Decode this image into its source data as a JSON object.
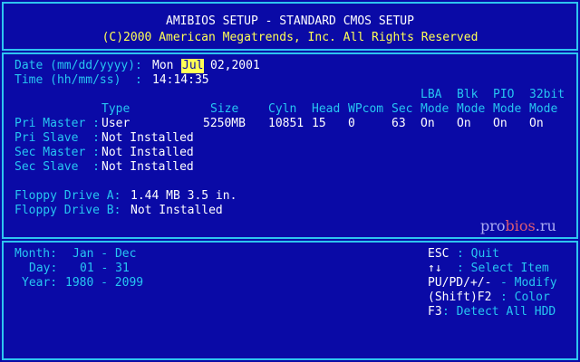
{
  "header": {
    "title": "AMIBIOS SETUP - STANDARD CMOS SETUP",
    "copyright": "(C)2000 American Megatrends, Inc. All Rights Reserved"
  },
  "datetime": {
    "date_label": "Date (mm/dd/yyyy):",
    "date_weekday": "Mon",
    "date_month": "Jul",
    "date_rest": "02,2001",
    "time_label": "Time (hh/mm/ss)  :",
    "time_value": "14:14:35"
  },
  "drives_table": {
    "columns": {
      "type": "Type",
      "size": "Size",
      "cyln": "Cyln",
      "head": "Head",
      "wpcom": "WPcom",
      "sec": "Sec",
      "lba_top": "LBA",
      "lba_bottom": "Mode",
      "blk_top": "Blk",
      "blk_bottom": "Mode",
      "pio_top": "PIO",
      "pio_bottom": "Mode",
      "bit32_top": "32bit",
      "bit32_bottom": "Mode"
    },
    "rows": [
      {
        "label": "Pri Master :",
        "type": "User",
        "size": "5250MB",
        "cyln": "10851",
        "head": "15",
        "wpcom": "0",
        "sec": "63",
        "lba": "On",
        "blk": "On",
        "pio": "On",
        "bit32": "On"
      },
      {
        "label": "Pri Slave  :",
        "type": "Not Installed"
      },
      {
        "label": "Sec Master :",
        "type": "Not Installed"
      },
      {
        "label": "Sec Slave  :",
        "type": "Not Installed"
      }
    ]
  },
  "floppy": {
    "a_label": "Floppy Drive A:",
    "a_value": "1.44 MB 3.5 in.",
    "b_label": "Floppy Drive B:",
    "b_value": "Not Installed"
  },
  "help_left": {
    "month_label": "Month:",
    "month_value": "Jan - Dec",
    "day_label": "Day:",
    "day_value": "01 - 31",
    "year_label": "Year:",
    "year_value": "1980 - 2099"
  },
  "help_right": {
    "esc_key": "ESC",
    "esc_action": ": Quit",
    "arrows_key": "↑↓",
    "arrows_action": ": Select Item",
    "pupd_key": "PU/PD/+/-",
    "pupd_action": "- Modify",
    "shiftf2_key": "(Shift)F2",
    "shiftf2_action": ": Color",
    "f3_key": "F3",
    "f3_action": ": Detect All HDD"
  },
  "watermark": {
    "left": "pro",
    "mid": "bios",
    "right": ".ru"
  },
  "colors": {
    "background": "#0a0aa6",
    "border": "#2ec4f0",
    "label": "#27c6f2",
    "value": "#ffffff",
    "highlight": "#ffff55"
  }
}
